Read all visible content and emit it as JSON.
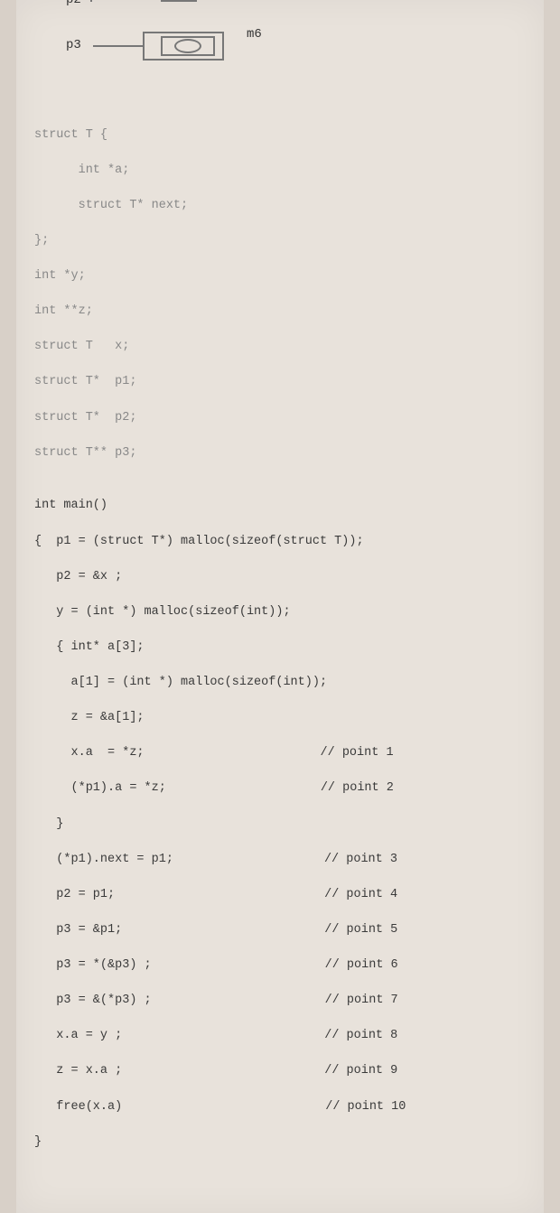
{
  "diagram": {
    "labels": {
      "p2": "p2",
      "p3": "p3",
      "m6": "m6"
    }
  },
  "code": {
    "l1": "struct T {",
    "l2": "      int *a;",
    "l3": "      struct T* next;",
    "l4": "};",
    "l5": "int *y;",
    "l6": "int **z;",
    "l7": "struct T   x;",
    "l8": "struct T*  p1;",
    "l9": "struct T*  p2;",
    "l10": "struct T** p3;",
    "l11": "",
    "l12": "int main()",
    "l13": "{  p1 = (struct T*) malloc(sizeof(struct T));",
    "l14": "   p2 = &x ;",
    "l15": "   y = (int *) malloc(sizeof(int));",
    "l16": "   { int* a[3];",
    "l17": "     a[1] = (int *) malloc(sizeof(int));",
    "l18": "     z = &a[1];",
    "l19a": "     x.a  = *z;",
    "l19c": "// point 1",
    "l20a": "     (*p1).a = *z;",
    "l20c": "// point 2",
    "l21": "   }",
    "l22a": "   (*p1).next = p1;",
    "l22c": "// point 3",
    "l23a": "   p2 = p1;",
    "l23c": "// point 4",
    "l24a": "   p3 = &p1;",
    "l24c": "// point 5",
    "l25a": "   p3 = *(&p3) ;",
    "l25c": "// point 6",
    "l26a": "   p3 = &(*p3) ;",
    "l26c": "// point 7",
    "l27a": "   x.a = y ;",
    "l27c": "// point 8",
    "l28a": "   z = x.a ;",
    "l28c": "// point 9",
    "l29a": "   free(x.a)",
    "l29c": "// point 10",
    "l30": "}"
  }
}
